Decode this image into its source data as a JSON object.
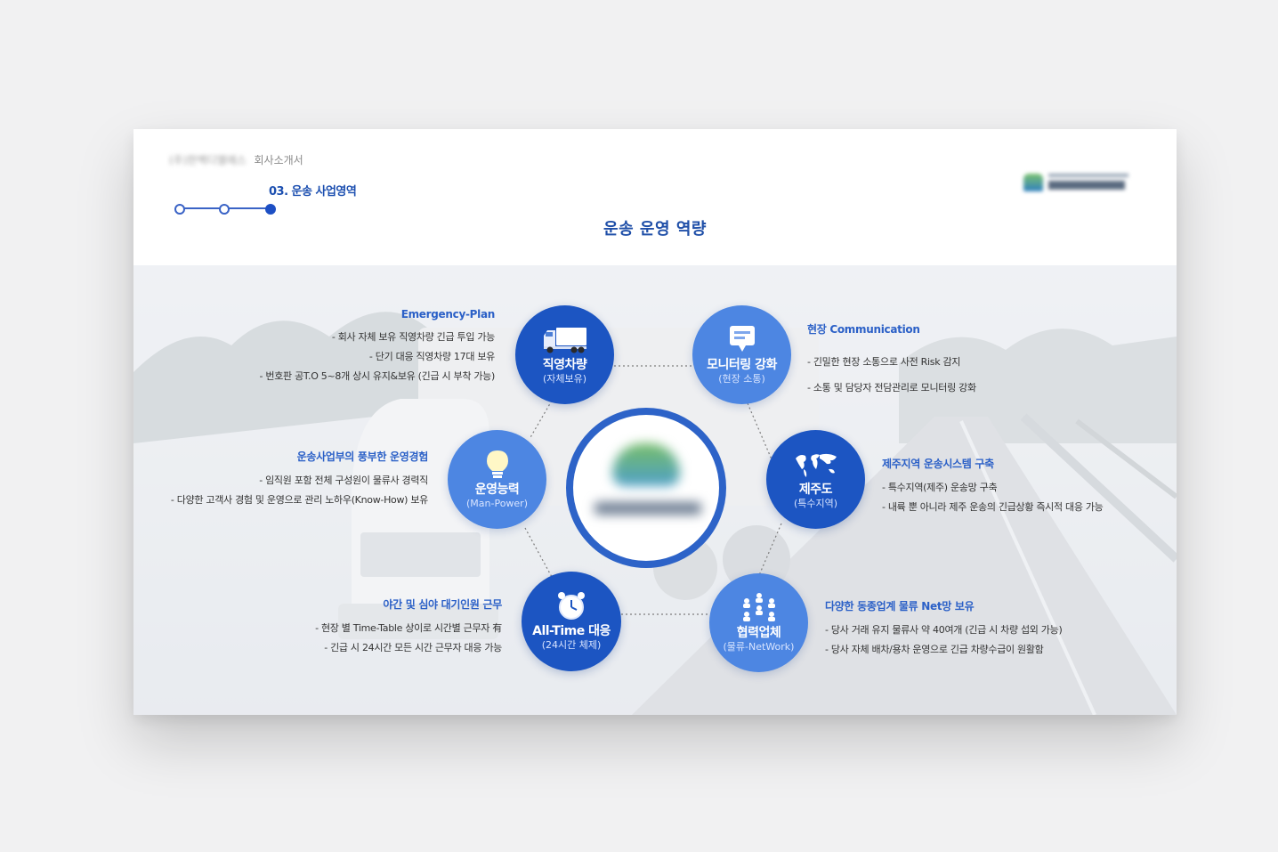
{
  "header": {
    "company_name": "(주)한백디엘에스",
    "doc_title": "회사소개서",
    "section": "03. 운송 사업영역",
    "page_title": "운송 운영 역량",
    "logo_text": "(주)한백디엘에스"
  },
  "center": {
    "logo_text": "한백디엘에스"
  },
  "nodes": [
    {
      "key": "vehicle",
      "title": "직영차량",
      "sub": "(자체보유)",
      "icon": "truck-icon"
    },
    {
      "key": "monitoring",
      "title": "모니터링 강화",
      "sub": "(현장 소통)",
      "icon": "chat-board-icon"
    },
    {
      "key": "jeju",
      "title": "제주도",
      "sub": "(특수지역)",
      "icon": "world-map-icon"
    },
    {
      "key": "partner",
      "title": "협력업체",
      "sub": "(물류-NetWork)",
      "icon": "people-network-icon"
    },
    {
      "key": "alltime",
      "title": "All-Time 대응",
      "sub": "(24시간 체제)",
      "icon": "alarm-clock-icon"
    },
    {
      "key": "manpower",
      "title": "운영능력",
      "sub": "(Man-Power)",
      "icon": "lightbulb-icon"
    }
  ],
  "descriptions": {
    "emergency": {
      "head": "Emergency-Plan",
      "lines": [
        "- 회사 자체 보유 직영차량 긴급 투입 가능",
        "- 단기 대응 직영차량 17대 보유",
        "- 번호판 공T.O 5~8개 상시 유지&보유 (긴급 시 부착 가능)"
      ]
    },
    "communication": {
      "head": "현장 Communication",
      "lines": [
        "- 긴밀한 현장 소통으로 사전 Risk 감지",
        "- 소통 및 담당자 전담관리로 모니터링 강화"
      ]
    },
    "experience": {
      "head": "운송사업부의 풍부한 운영경험",
      "lines": [
        "- 임직원 포함 전체 구성원이 물류사 경력직",
        "- 다양한 고객사 경험 및 운영으로 관리 노하우(Know-How) 보유"
      ]
    },
    "jeju": {
      "head": "제주지역 운송시스템 구축",
      "lines": [
        "- 특수지역(제주) 운송망 구축",
        "- 내륙 뿐 아니라 제주 운송의 긴급상황 즉시적 대응 가능"
      ]
    },
    "night": {
      "head": "야간 및 심야 대기인원 근무",
      "lines": [
        "- 현장 별 Time-Table 상이로 시간별 근무자 有",
        "- 긴급 시 24시간 모든 시간 근무자 대응 가능"
      ]
    },
    "network": {
      "head": "다양한 동종업계 물류 Net망 보유",
      "lines": [
        "- 당사 거래 유지 물류사 약 40여개 (긴급 시 차량 섭외 가능)",
        "- 당사 자체 배차/용차 운영으로 긴급 차량수급이 원활함"
      ]
    }
  },
  "colors": {
    "primary": "#1c55c2",
    "secondary": "#4d86e2",
    "heading": "#2b60c7"
  }
}
